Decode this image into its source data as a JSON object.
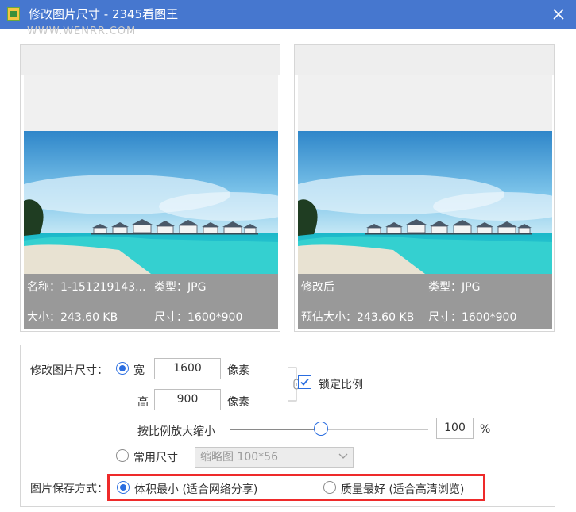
{
  "window": {
    "title": "修改图片尺寸 - 2345看图王",
    "watermark": "WWW.WENRR.COM",
    "accent_color": "#4677cf",
    "icons": {
      "app": "app-logo-icon",
      "close": "close-icon"
    }
  },
  "original": {
    "name_label": "名称：1-151219143...",
    "type_label": "类型：JPG",
    "size_label": "大小：243.60 KB",
    "dims_label": "尺寸：1600*900"
  },
  "preview": {
    "status_label": "修改后",
    "type_label": "类型：JPG",
    "size_label": "预估大小：243.60 KB",
    "dims_label": "尺寸：1600*900"
  },
  "settings": {
    "resize_label": "修改图片尺寸：",
    "width_label": "宽",
    "width_value": "1600",
    "height_label": "高",
    "height_value": "900",
    "pixel_unit_1": "像素",
    "pixel_unit_2": "像素",
    "lock_ratio_label": "锁定比例",
    "lock_ratio_checked": true,
    "scale_label": "按比例放大缩小",
    "scale_value": "100",
    "scale_fraction": 0.46,
    "percent_unit": "%",
    "common_size_label": "常用尺寸",
    "common_size_selected": "缩略图 100*56",
    "save_mode_label": "图片保存方式：",
    "save_option_small": "体积最小 (适合网络分享)",
    "save_option_quality": "质量最好 (适合高清浏览)",
    "highlight_color": "#ee2a2a"
  }
}
